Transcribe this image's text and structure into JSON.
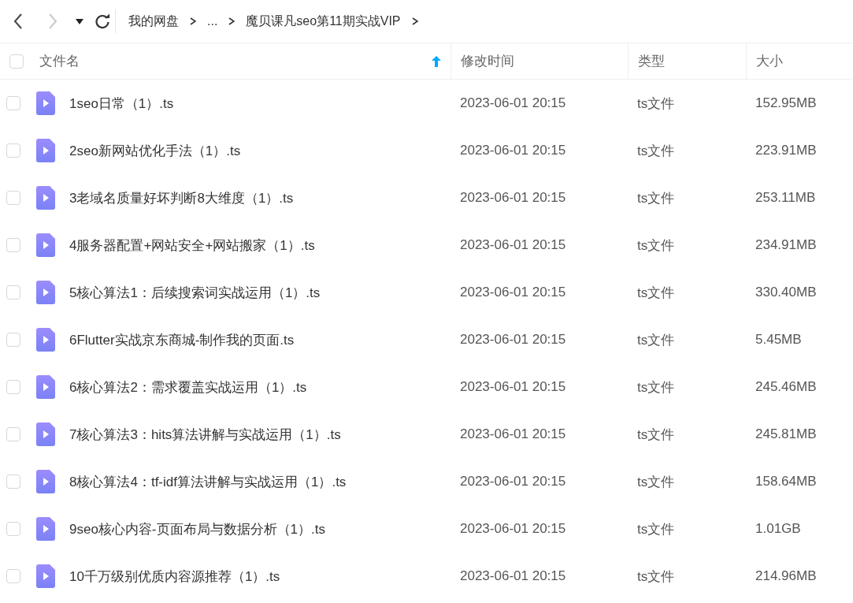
{
  "toolbar": {
    "back": {
      "disabled": false
    },
    "forward": {
      "disabled": true
    },
    "breadcrumb": [
      {
        "label": "我的网盘"
      },
      {
        "label": "..."
      },
      {
        "label": "魔贝课凡seo第11期实战VIP"
      }
    ]
  },
  "table": {
    "select_all": {
      "checked": false
    },
    "columns": [
      {
        "label": "文件名",
        "sorted": true
      },
      {
        "label": "修改时间"
      },
      {
        "label": "类型"
      },
      {
        "label": "大小"
      }
    ],
    "rows": [
      {
        "checked": false,
        "name": "1seo日常（1）.ts",
        "modified": "2023-06-01 20:15",
        "type": "ts文件",
        "size": "152.95MB"
      },
      {
        "checked": false,
        "name": "2seo新网站优化手法（1）.ts",
        "modified": "2023-06-01 20:15",
        "type": "ts文件",
        "size": "223.91MB"
      },
      {
        "checked": false,
        "name": "3老域名质量好坏判断8大维度（1）.ts",
        "modified": "2023-06-01 20:15",
        "type": "ts文件",
        "size": "253.11MB"
      },
      {
        "checked": false,
        "name": "4服务器配置+网站安全+网站搬家（1）.ts",
        "modified": "2023-06-01 20:15",
        "type": "ts文件",
        "size": "234.91MB"
      },
      {
        "checked": false,
        "name": "5核心算法1：后续搜索词实战运用（1）.ts",
        "modified": "2023-06-01 20:15",
        "type": "ts文件",
        "size": "330.40MB"
      },
      {
        "checked": false,
        "name": "6Flutter实战京东商城-制作我的页面.ts",
        "modified": "2023-06-01 20:15",
        "type": "ts文件",
        "size": "5.45MB"
      },
      {
        "checked": false,
        "name": "6核心算法2：需求覆盖实战运用（1）.ts",
        "modified": "2023-06-01 20:15",
        "type": "ts文件",
        "size": "245.46MB"
      },
      {
        "checked": false,
        "name": "7核心算法3：hits算法讲解与实战运用（1）.ts",
        "modified": "2023-06-01 20:15",
        "type": "ts文件",
        "size": "245.81MB"
      },
      {
        "checked": false,
        "name": "8核心算法4：tf-idf算法讲解与实战运用（1）.ts",
        "modified": "2023-06-01 20:15",
        "type": "ts文件",
        "size": "158.64MB"
      },
      {
        "checked": false,
        "name": "9seo核心内容-页面布局与数据分析（1）.ts",
        "modified": "2023-06-01 20:15",
        "type": "ts文件",
        "size": "1.01GB"
      },
      {
        "checked": false,
        "name": "10千万级别优质内容源推荐（1）.ts",
        "modified": "2023-06-01 20:15",
        "type": "ts文件",
        "size": "214.96MB"
      }
    ]
  }
}
